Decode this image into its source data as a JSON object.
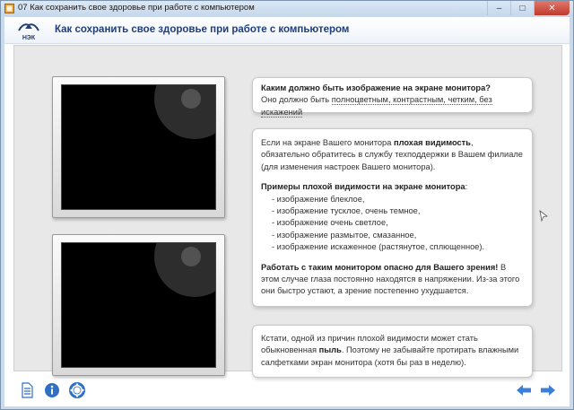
{
  "window": {
    "title": "07 Как сохранить свое здоровье при работе с компьютером",
    "minimize": "–",
    "maximize": "□",
    "close": "✕"
  },
  "header": {
    "logo_text": "НЭК",
    "title": "Как сохранить свое здоровье при работе с компьютером"
  },
  "card1": {
    "question": "Каким должно быть изображение на экране монитора?",
    "answer_prefix": "Оно должно быть ",
    "answer_underlined": "полноцветным, контрастным, четким, без искажений"
  },
  "card2": {
    "p1_a": "Если на экране Вашего монитора ",
    "p1_bold": "плохая видимость",
    "p1_b": ", обязательно обратитесь в службу техподдержки в Вашем филиале (для изменения настроек Вашего монитора).",
    "examples_title": "Примеры плохой видимости на экране монитора",
    "examples_colon": ":",
    "items": [
      "- изображение блеклое,",
      "- изображение тусклое, очень темное,",
      "- изображение очень светлое,",
      "- изображение размытое, смазанное,",
      "- изображение искаженное (растянутое, сплющенное)."
    ],
    "p3_bold": "Работать с таким монитором опасно для Вашего зрения!",
    "p3_rest": " В этом случае глаза постоянно находятся в напряжении. Из-за этого они быстро устают, а зрение постепенно ухудшается."
  },
  "card3": {
    "a": "Кстати, одной из причин плохой видимости может стать обыкновенная ",
    "bold": "пыль",
    "b": ". Поэтому не забывайте протирать влажными салфетками экран монитора (хотя бы раз в неделю)."
  },
  "footer": {
    "icons": [
      "document-icon",
      "info-icon",
      "help-lifebuoy-icon",
      "back-arrow-icon",
      "forward-arrow-icon"
    ]
  },
  "colors": {
    "title_blue": "#1f3d7a",
    "arrow_blue": "#3d7fd6"
  }
}
